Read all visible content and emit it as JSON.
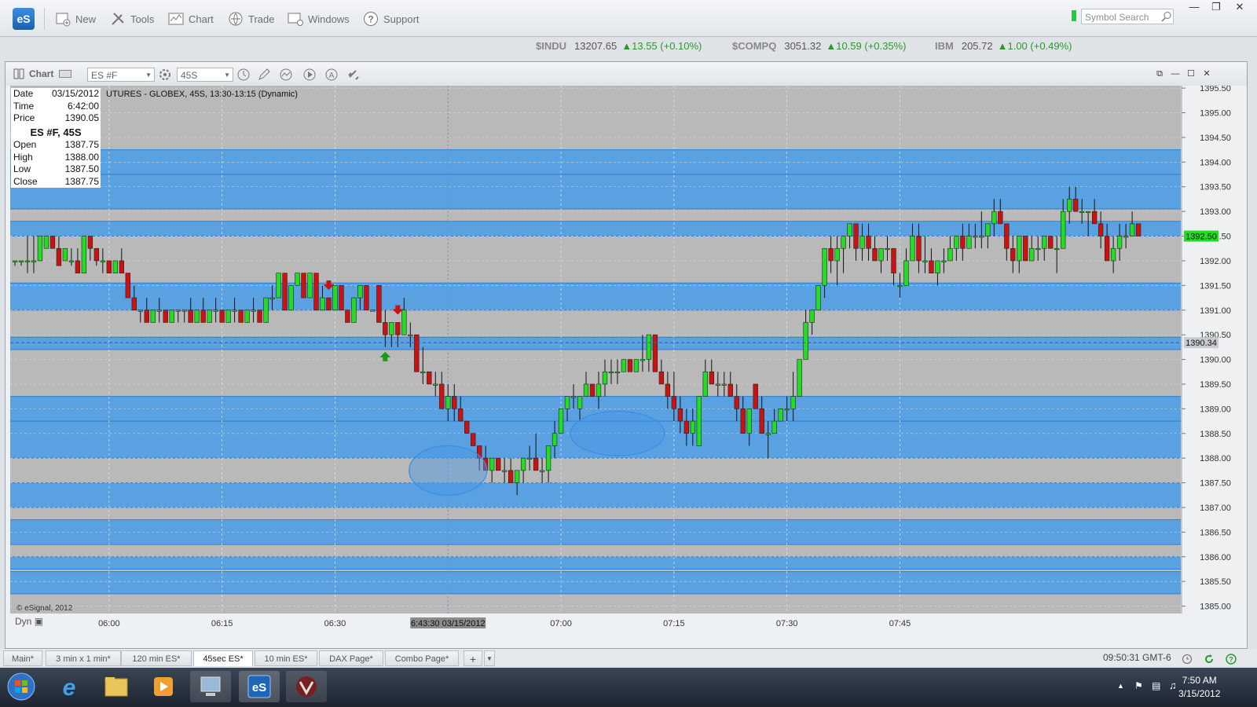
{
  "app": {
    "logo_text": "eS",
    "toolbar": [
      {
        "label": "New",
        "icon": "new-chart-icon"
      },
      {
        "label": "Tools",
        "icon": "tools-icon"
      },
      {
        "label": "Chart",
        "icon": "chart-icon"
      },
      {
        "label": "Trade",
        "icon": "trade-icon"
      },
      {
        "label": "Windows",
        "icon": "windows-icon"
      },
      {
        "label": "Support",
        "icon": "help-icon"
      }
    ],
    "symbol_search_placeholder": "Symbol Search"
  },
  "tickers": [
    {
      "symbol": "$INDU",
      "value": "13207.65",
      "change": "13.55 (+0.10%)"
    },
    {
      "symbol": "$COMPQ",
      "value": "3051.32",
      "change": "10.59 (+0.35%)"
    },
    {
      "symbol": "IBM",
      "value": "205.72",
      "change": "1.00 (+0.49%)"
    }
  ],
  "chart_window": {
    "label": "Chart",
    "symbol": "ES #F",
    "interval": "45S",
    "title": "UTURES - GLOBEX, 45S, 13:30-13:15 (Dynamic)",
    "copyright": "© eSignal, 2012",
    "dyn_label": "Dyn",
    "crosshair_label": "6:43:30 03/15/2012",
    "last_price_label": "1392.50",
    "line_price_label": "1390.34"
  },
  "info": {
    "rows_top": [
      {
        "k": "Date",
        "v": "03/15/2012"
      },
      {
        "k": "Time",
        "v": "6:42:00"
      },
      {
        "k": "Price",
        "v": "1390.05"
      }
    ],
    "heading": "ES #F, 45S",
    "rows_ohlc": [
      {
        "k": "Open",
        "v": "1387.75"
      },
      {
        "k": "High",
        "v": "1388.00"
      },
      {
        "k": "Low",
        "v": "1387.50"
      },
      {
        "k": "Close",
        "v": "1387.75"
      }
    ]
  },
  "chart_data": {
    "type": "candlestick",
    "x_ticks": [
      "06:00",
      "06:15",
      "06:30",
      "07:00",
      "07:15",
      "07:30",
      "07:45"
    ],
    "y_ticks": [
      "1395.50",
      "1395.00",
      "1394.50",
      "1394.00",
      "1393.50",
      "1393.00",
      "1392.50",
      "1392.00",
      "1391.50",
      "1391.00",
      "1390.50",
      "1390.00",
      "1389.50",
      "1389.00",
      "1388.50",
      "1388.00",
      "1387.50",
      "1387.00",
      "1386.50",
      "1386.00",
      "1385.50",
      "1385.00"
    ],
    "ylim": [
      1384.85,
      1395.55
    ],
    "colors": {
      "up": "#22dd22",
      "down": "#cc1111",
      "band": "#4f9fe6",
      "bg": "#b9b9b9"
    },
    "bands": [
      [
        1393.75,
        1394.25
      ],
      [
        1393.05,
        1393.75
      ],
      [
        1392.5,
        1392.8
      ],
      [
        1391.0,
        1391.55
      ],
      [
        1390.2,
        1390.45
      ],
      [
        1388.75,
        1389.25
      ],
      [
        1388.0,
        1388.75
      ],
      [
        1387.0,
        1387.5
      ],
      [
        1386.25,
        1386.75
      ],
      [
        1385.75,
        1386.0
      ],
      [
        1385.25,
        1385.7
      ]
    ],
    "candles": [
      [
        1392.0,
        1392.0,
        1391.9,
        1392.0
      ],
      [
        1392.0,
        1392.0,
        1391.9,
        1392.0
      ],
      [
        1392.0,
        1392.5,
        1391.75,
        1392.0
      ],
      [
        1392.0,
        1392.5,
        1391.75,
        1392.0
      ],
      [
        1392.0,
        1392.5,
        1392.0,
        1392.5
      ],
      [
        1392.25,
        1392.5,
        1392.25,
        1392.5
      ],
      [
        1392.5,
        1392.5,
        1392.25,
        1392.25
      ],
      [
        1392.25,
        1392.5,
        1391.9,
        1391.9
      ],
      [
        1392.0,
        1392.25,
        1392.0,
        1392.25
      ],
      [
        1392.0,
        1392.25,
        1391.9,
        1392.0
      ],
      [
        1392.0,
        1392.25,
        1391.75,
        1391.75
      ],
      [
        1391.75,
        1392.5,
        1391.75,
        1392.5
      ],
      [
        1392.5,
        1392.5,
        1392.0,
        1392.25
      ],
      [
        1392.25,
        1392.25,
        1391.9,
        1392.0
      ],
      [
        1392.0,
        1392.25,
        1391.75,
        1392.0
      ],
      [
        1392.0,
        1392.0,
        1391.75,
        1391.75
      ],
      [
        1391.75,
        1392.0,
        1391.75,
        1392.0
      ],
      [
        1392.0,
        1392.25,
        1391.75,
        1391.75
      ],
      [
        1391.75,
        1391.75,
        1391.25,
        1391.25
      ],
      [
        1391.25,
        1391.5,
        1391.0,
        1391.0
      ],
      [
        1391.0,
        1391.0,
        1390.75,
        1391.0
      ],
      [
        1391.0,
        1391.25,
        1390.75,
        1390.75
      ],
      [
        1390.75,
        1391.0,
        1390.75,
        1391.0
      ],
      [
        1391.0,
        1391.25,
        1390.75,
        1391.0
      ],
      [
        1391.0,
        1391.0,
        1390.75,
        1390.75
      ],
      [
        1390.75,
        1391.0,
        1390.75,
        1391.0
      ],
      [
        1391.0,
        1391.0,
        1390.75,
        1391.0
      ],
      [
        1391.0,
        1391.0,
        1390.75,
        1391.0
      ],
      [
        1391.0,
        1391.25,
        1390.75,
        1390.75
      ],
      [
        1390.75,
        1391.0,
        1390.75,
        1391.0
      ],
      [
        1391.0,
        1391.25,
        1390.75,
        1390.75
      ],
      [
        1390.75,
        1391.0,
        1390.75,
        1391.0
      ],
      [
        1391.0,
        1391.25,
        1390.75,
        1391.0
      ],
      [
        1391.0,
        1391.0,
        1390.75,
        1390.75
      ],
      [
        1390.75,
        1391.0,
        1390.75,
        1391.0
      ],
      [
        1391.0,
        1391.25,
        1390.75,
        1391.0
      ],
      [
        1391.0,
        1391.0,
        1390.75,
        1390.75
      ],
      [
        1390.75,
        1391.0,
        1390.75,
        1391.0
      ],
      [
        1391.0,
        1391.25,
        1390.75,
        1391.0
      ],
      [
        1391.0,
        1391.0,
        1390.75,
        1390.75
      ],
      [
        1390.75,
        1391.25,
        1390.75,
        1391.25
      ],
      [
        1391.25,
        1391.5,
        1391.0,
        1391.25
      ],
      [
        1391.25,
        1391.75,
        1391.25,
        1391.75
      ],
      [
        1391.75,
        1391.75,
        1391.0,
        1391.0
      ],
      [
        1391.0,
        1391.5,
        1391.0,
        1391.5
      ],
      [
        1391.5,
        1391.75,
        1391.5,
        1391.75
      ],
      [
        1391.75,
        1391.75,
        1391.25,
        1391.25
      ],
      [
        1391.25,
        1391.75,
        1391.25,
        1391.75
      ],
      [
        1391.75,
        1391.75,
        1391.0,
        1391.0
      ],
      [
        1391.0,
        1391.5,
        1391.0,
        1391.25
      ],
      [
        1391.25,
        1391.25,
        1391.0,
        1391.0
      ],
      [
        1391.0,
        1391.5,
        1391.0,
        1391.5
      ],
      [
        1391.5,
        1391.5,
        1391.0,
        1391.0
      ],
      [
        1391.0,
        1391.0,
        1390.75,
        1390.75
      ],
      [
        1390.75,
        1391.25,
        1390.75,
        1391.25
      ],
      [
        1391.25,
        1391.5,
        1391.0,
        1391.5
      ],
      [
        1391.5,
        1391.5,
        1391.0,
        1391.0
      ],
      [
        1391.0,
        1391.0,
        1391.0,
        1391.0
      ],
      [
        1391.5,
        1391.5,
        1390.75,
        1390.75
      ],
      [
        1390.75,
        1391.0,
        1390.25,
        1390.5
      ],
      [
        1390.5,
        1390.75,
        1390.25,
        1390.75
      ],
      [
        1390.75,
        1390.75,
        1390.25,
        1390.5
      ],
      [
        1390.5,
        1391.25,
        1390.5,
        1391.0
      ],
      [
        1390.5,
        1390.75,
        1390.25,
        1390.5
      ],
      [
        1390.5,
        1390.5,
        1389.75,
        1389.75
      ],
      [
        1389.75,
        1390.25,
        1389.5,
        1389.75
      ],
      [
        1389.75,
        1389.75,
        1389.5,
        1389.5
      ],
      [
        1389.5,
        1389.75,
        1389.25,
        1389.5
      ],
      [
        1389.5,
        1389.75,
        1389.0,
        1389.0
      ],
      [
        1389.0,
        1389.5,
        1388.75,
        1389.25
      ],
      [
        1389.25,
        1389.5,
        1388.75,
        1389.0
      ],
      [
        1389.0,
        1389.25,
        1388.75,
        1388.75
      ],
      [
        1388.75,
        1388.75,
        1388.5,
        1388.5
      ],
      [
        1388.5,
        1388.5,
        1388.25,
        1388.25
      ],
      [
        1388.25,
        1388.25,
        1387.75,
        1388.0
      ],
      [
        1388.0,
        1388.25,
        1387.75,
        1387.75
      ],
      [
        1387.75,
        1388.0,
        1387.5,
        1388.0
      ],
      [
        1388.0,
        1388.0,
        1387.75,
        1387.75
      ],
      [
        1387.75,
        1388.0,
        1387.5,
        1387.75
      ],
      [
        1387.75,
        1388.0,
        1387.5,
        1387.5
      ],
      [
        1387.5,
        1387.75,
        1387.25,
        1387.75
      ],
      [
        1387.75,
        1388.0,
        1387.5,
        1388.0
      ],
      [
        1388.0,
        1388.25,
        1387.75,
        1388.0
      ],
      [
        1388.0,
        1388.5,
        1387.75,
        1387.75
      ],
      [
        1387.75,
        1388.0,
        1387.5,
        1387.75
      ],
      [
        1387.75,
        1388.25,
        1387.5,
        1388.25
      ],
      [
        1388.25,
        1388.75,
        1388.0,
        1388.5
      ],
      [
        1388.5,
        1389.0,
        1388.5,
        1389.0
      ],
      [
        1389.0,
        1389.25,
        1388.75,
        1389.25
      ],
      [
        1389.25,
        1389.5,
        1389.0,
        1389.25
      ],
      [
        1389.0,
        1389.25,
        1388.75,
        1389.25
      ],
      [
        1389.25,
        1389.75,
        1389.25,
        1389.5
      ],
      [
        1389.5,
        1389.5,
        1389.25,
        1389.25
      ],
      [
        1389.25,
        1389.75,
        1389.0,
        1389.5
      ],
      [
        1389.5,
        1390.0,
        1389.25,
        1389.75
      ],
      [
        1389.75,
        1390.0,
        1389.5,
        1389.75
      ],
      [
        1389.75,
        1390.0,
        1389.5,
        1389.75
      ],
      [
        1389.75,
        1390.0,
        1389.75,
        1390.0
      ],
      [
        1390.0,
        1390.0,
        1389.75,
        1389.75
      ],
      [
        1389.75,
        1390.0,
        1389.75,
        1390.0
      ],
      [
        1390.0,
        1390.5,
        1389.75,
        1390.0
      ],
      [
        1390.0,
        1390.5,
        1389.75,
        1390.5
      ],
      [
        1390.5,
        1390.5,
        1389.75,
        1389.75
      ],
      [
        1389.75,
        1390.0,
        1389.5,
        1389.5
      ],
      [
        1389.5,
        1389.75,
        1389.0,
        1389.25
      ],
      [
        1389.25,
        1389.75,
        1388.75,
        1389.0
      ],
      [
        1389.0,
        1389.25,
        1388.5,
        1388.75
      ],
      [
        1388.75,
        1389.0,
        1388.25,
        1388.5
      ],
      [
        1388.5,
        1389.0,
        1388.25,
        1388.75
      ],
      [
        1388.25,
        1389.25,
        1388.25,
        1389.25
      ],
      [
        1389.25,
        1390.0,
        1389.25,
        1389.75
      ],
      [
        1389.75,
        1390.0,
        1389.5,
        1389.5
      ],
      [
        1389.5,
        1389.75,
        1389.25,
        1389.5
      ],
      [
        1389.5,
        1389.75,
        1389.25,
        1389.5
      ],
      [
        1389.5,
        1389.75,
        1389.25,
        1389.25
      ],
      [
        1389.25,
        1389.5,
        1388.75,
        1389.0
      ],
      [
        1389.0,
        1389.25,
        1388.5,
        1388.5
      ],
      [
        1388.5,
        1389.0,
        1388.25,
        1389.0
      ],
      [
        1389.5,
        1389.5,
        1389.0,
        1389.0
      ],
      [
        1389.0,
        1389.25,
        1388.5,
        1388.5
      ],
      [
        1388.5,
        1388.75,
        1388.0,
        1388.5
      ],
      [
        1388.5,
        1389.0,
        1388.5,
        1388.75
      ],
      [
        1388.75,
        1389.0,
        1388.75,
        1389.0
      ],
      [
        1389.0,
        1389.25,
        1388.75,
        1389.0
      ],
      [
        1389.0,
        1389.75,
        1388.75,
        1389.25
      ],
      [
        1389.25,
        1390.0,
        1389.25,
        1390.0
      ],
      [
        1390.0,
        1391.0,
        1390.0,
        1390.75
      ],
      [
        1390.75,
        1391.0,
        1390.5,
        1391.0
      ],
      [
        1391.0,
        1391.5,
        1391.0,
        1391.5
      ],
      [
        1391.5,
        1392.25,
        1391.25,
        1392.25
      ],
      [
        1392.25,
        1392.5,
        1391.75,
        1392.0
      ],
      [
        1392.0,
        1392.5,
        1391.5,
        1392.25
      ],
      [
        1392.25,
        1392.5,
        1391.75,
        1392.5
      ],
      [
        1392.5,
        1392.75,
        1392.25,
        1392.75
      ],
      [
        1392.75,
        1392.75,
        1392.0,
        1392.25
      ],
      [
        1392.25,
        1392.75,
        1392.0,
        1392.5
      ],
      [
        1392.5,
        1392.75,
        1392.0,
        1392.25
      ],
      [
        1392.25,
        1392.5,
        1392.0,
        1392.0
      ],
      [
        1392.0,
        1392.25,
        1391.75,
        1392.25
      ],
      [
        1392.25,
        1392.5,
        1392.0,
        1392.25
      ],
      [
        1392.25,
        1392.25,
        1391.5,
        1391.75
      ],
      [
        1391.5,
        1391.75,
        1391.25,
        1391.5
      ],
      [
        1391.5,
        1392.25,
        1391.5,
        1392.0
      ],
      [
        1392.0,
        1392.75,
        1392.0,
        1392.5
      ],
      [
        1392.5,
        1392.75,
        1391.75,
        1392.0
      ],
      [
        1392.0,
        1392.5,
        1391.75,
        1392.0
      ],
      [
        1392.0,
        1392.25,
        1391.75,
        1391.75
      ],
      [
        1391.75,
        1392.0,
        1391.5,
        1392.0
      ],
      [
        1392.0,
        1392.25,
        1391.75,
        1392.0
      ],
      [
        1392.0,
        1392.5,
        1392.0,
        1392.25
      ],
      [
        1392.25,
        1392.5,
        1392.0,
        1392.5
      ],
      [
        1392.5,
        1392.75,
        1392.0,
        1392.25
      ],
      [
        1392.25,
        1392.75,
        1392.25,
        1392.5
      ],
      [
        1392.5,
        1392.75,
        1392.25,
        1392.5
      ],
      [
        1392.5,
        1393.0,
        1392.25,
        1392.5
      ],
      [
        1392.5,
        1392.75,
        1392.25,
        1392.75
      ],
      [
        1392.75,
        1393.25,
        1392.5,
        1393.0
      ],
      [
        1393.0,
        1393.25,
        1392.75,
        1392.75
      ],
      [
        1392.75,
        1392.75,
        1392.0,
        1392.25
      ],
      [
        1392.25,
        1392.5,
        1391.75,
        1392.0
      ],
      [
        1392.0,
        1392.5,
        1391.75,
        1392.5
      ],
      [
        1392.5,
        1392.5,
        1392.0,
        1392.0
      ],
      [
        1392.0,
        1392.5,
        1392.0,
        1392.25
      ],
      [
        1392.25,
        1392.5,
        1392.0,
        1392.25
      ],
      [
        1392.25,
        1392.5,
        1392.0,
        1392.5
      ],
      [
        1392.5,
        1392.5,
        1392.25,
        1392.25
      ],
      [
        1392.25,
        1392.5,
        1391.75,
        1392.25
      ],
      [
        1392.25,
        1393.25,
        1392.25,
        1393.0
      ],
      [
        1393.0,
        1393.5,
        1392.75,
        1393.25
      ],
      [
        1393.25,
        1393.5,
        1393.0,
        1393.0
      ],
      [
        1393.0,
        1393.25,
        1392.75,
        1393.0
      ],
      [
        1393.0,
        1393.0,
        1392.5,
        1393.0
      ],
      [
        1393.0,
        1393.25,
        1392.75,
        1392.75
      ],
      [
        1392.75,
        1393.0,
        1392.25,
        1392.5
      ],
      [
        1392.5,
        1392.75,
        1392.0,
        1392.0
      ],
      [
        1392.0,
        1392.5,
        1391.75,
        1392.25
      ],
      [
        1392.25,
        1392.75,
        1392.0,
        1392.5
      ],
      [
        1392.5,
        1392.75,
        1392.25,
        1392.5
      ],
      [
        1392.5,
        1393.0,
        1392.5,
        1392.75
      ],
      [
        1392.75,
        1392.75,
        1392.5,
        1392.5
      ]
    ],
    "signals": [
      {
        "bar": 50,
        "type": "sell"
      },
      {
        "bar": 59,
        "type": "buy"
      },
      {
        "bar": 61,
        "type": "sell"
      }
    ],
    "ellipses": [
      {
        "bar": 69,
        "price": 1387.75,
        "half_bars": 6.2,
        "half_price": 0.5
      },
      {
        "bar": 96,
        "price": 1388.5,
        "half_bars": 7.5,
        "half_price": 0.45
      }
    ],
    "x_tick_bars": [
      15,
      33,
      51,
      87,
      105,
      123,
      141
    ],
    "crosshair_bar": 69,
    "last_price": 1392.5,
    "line_price": 1390.34
  },
  "tabs": [
    {
      "label": "Main*",
      "active": false
    },
    {
      "label": "3 min x 1 min*",
      "active": false
    },
    {
      "label": "120 min ES*",
      "active": false
    },
    {
      "label": "45sec ES*",
      "active": true
    },
    {
      "label": "10 min ES*",
      "active": false
    },
    {
      "label": "DAX Page*",
      "active": false
    },
    {
      "label": "Combo Page*",
      "active": false
    }
  ],
  "status": {
    "clock": "09:50:31 GMT-6"
  },
  "taskbar": {
    "time": "7:50 AM",
    "date": "3/15/2012"
  }
}
